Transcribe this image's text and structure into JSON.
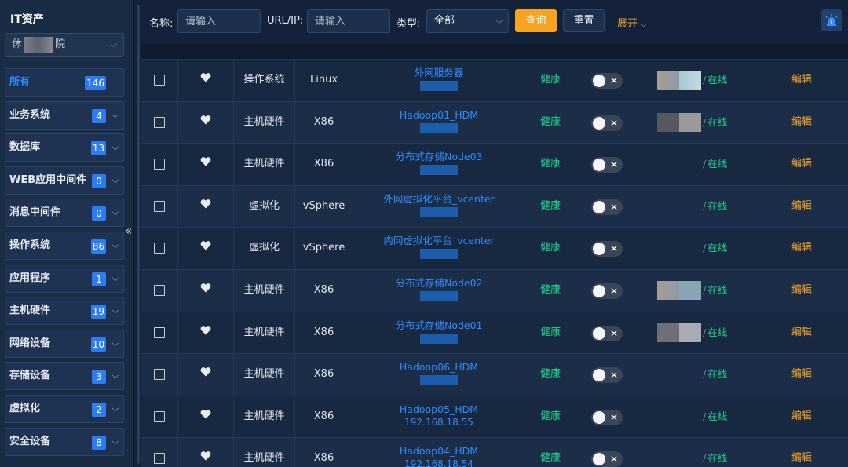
{
  "sidebar": {
    "title": "IT资产",
    "org_select": {
      "prefix": "休",
      "suffix": "院"
    },
    "collapse_icon": "«",
    "categories": [
      {
        "label": "所有",
        "count": "146",
        "active": true
      },
      {
        "label": "业务系统",
        "count": "4"
      },
      {
        "label": "数据库",
        "count": "13"
      },
      {
        "label": "WEB应用中间件",
        "count": "0"
      },
      {
        "label": "消息中间件",
        "count": "0"
      },
      {
        "label": "操作系统",
        "count": "86"
      },
      {
        "label": "应用程序",
        "count": "1"
      },
      {
        "label": "主机硬件",
        "count": "19"
      },
      {
        "label": "网络设备",
        "count": "10"
      },
      {
        "label": "存储设备",
        "count": "3"
      },
      {
        "label": "虚拟化",
        "count": "2"
      },
      {
        "label": "安全设备",
        "count": "8"
      }
    ]
  },
  "toolbar": {
    "name_label": "名称:",
    "name_placeholder": "请输入",
    "url_label": "URL/IP:",
    "url_placeholder": "请输入",
    "type_label": "类型:",
    "type_value": "全部",
    "query_label": "查询",
    "reset_label": "重置",
    "expand_label": "展开",
    "alarm_icon": "siren-icon"
  },
  "colors": {
    "accent_blue": "#2f8bff",
    "health_green": "#1fcf8b",
    "edit_orange": "#f0a127",
    "query_button": "#f6a321"
  },
  "table": {
    "rows": [
      {
        "type": "操作系统",
        "subtype": "Linux",
        "name": "外网服务器",
        "ip": "",
        "health": "健康",
        "online_sep": "/",
        "status": "在线",
        "edit": "编辑"
      },
      {
        "type": "主机硬件",
        "subtype": "X86",
        "name": "Hadoop01_HDM",
        "ip": "",
        "health": "健康",
        "online_sep": "/",
        "status": "在线",
        "edit": "编辑"
      },
      {
        "type": "主机硬件",
        "subtype": "X86",
        "name": "分布式存储Node03",
        "ip": "",
        "health": "健康",
        "online_sep": "/",
        "status": "在线",
        "edit": "编辑"
      },
      {
        "type": "虚拟化",
        "subtype": "vSphere",
        "name": "外网虚拟化平台_vcenter",
        "ip": "",
        "health": "健康",
        "online_sep": "/",
        "status": "在线",
        "edit": "编辑"
      },
      {
        "type": "虚拟化",
        "subtype": "vSphere",
        "name": "内网虚拟化平台_vcenter",
        "ip": "",
        "health": "健康",
        "online_sep": "/",
        "status": "在线",
        "edit": "编辑"
      },
      {
        "type": "主机硬件",
        "subtype": "X86",
        "name": "分布式存储Node02",
        "ip": "",
        "health": "健康",
        "online_sep": "/",
        "status": "在线",
        "edit": "编辑"
      },
      {
        "type": "主机硬件",
        "subtype": "X86",
        "name": "分布式存储Node01",
        "ip": "",
        "health": "健康",
        "online_sep": "/",
        "status": "在线",
        "edit": "编辑"
      },
      {
        "type": "主机硬件",
        "subtype": "X86",
        "name": "Hadoop06_HDM",
        "ip": "",
        "health": "健康",
        "online_sep": "/",
        "status": "在线",
        "edit": "编辑"
      },
      {
        "type": "主机硬件",
        "subtype": "X86",
        "name": "Hadoop05_HDM",
        "ip": "192.168.18.55",
        "health": "健康",
        "online_sep": "/",
        "status": "在线",
        "edit": "编辑"
      },
      {
        "type": "主机硬件",
        "subtype": "X86",
        "name": "Hadoop04_HDM",
        "ip": "192.168.18.54",
        "health": "健康",
        "online_sep": "/",
        "status": "在线",
        "edit": "编辑"
      }
    ]
  }
}
